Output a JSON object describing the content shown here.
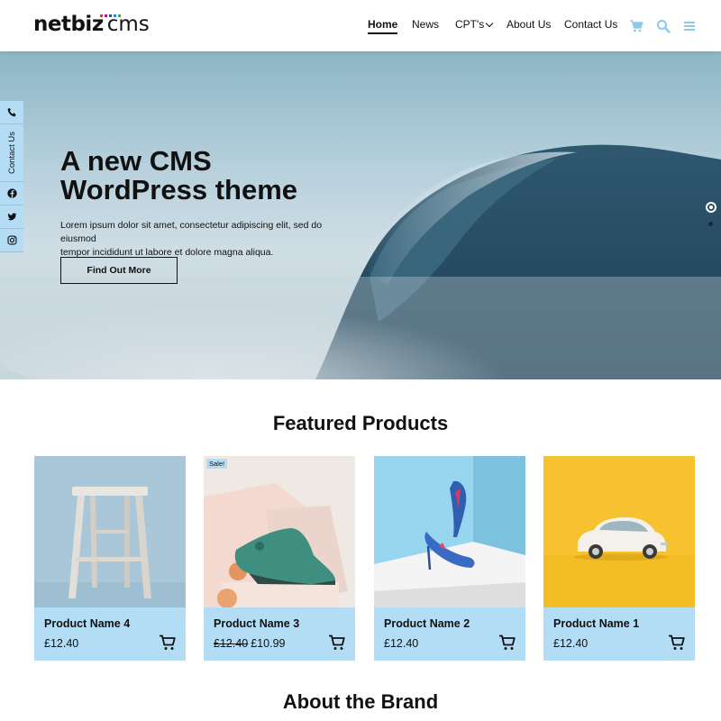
{
  "header": {
    "logo_bold": "netbiz",
    "logo_light": "cms",
    "logo_dot_colors": [
      "#e53935",
      "#8e24aa",
      "#3949ab",
      "#1e88e5",
      "#43a047"
    ],
    "nav": [
      "Home",
      "News",
      "CPT's",
      "About Us",
      "Contact Us"
    ],
    "icon_color": "#8ec8ea"
  },
  "side_tabs": {
    "contact_label": "Contact Us",
    "icons": [
      "phone-icon",
      "facebook-icon",
      "twitter-icon",
      "instagram-icon"
    ]
  },
  "hero": {
    "title_line1": "A new CMS",
    "title_line2": "WordPress theme",
    "text_line1": "Lorem ipsum dolor sit amet, consectetur adipiscing elit, sed do eiusmod",
    "text_line2": "tempor incididunt ut labore et dolore magna aliqua.",
    "button": "Find Out More",
    "slides": 2,
    "active_slide": 1
  },
  "featured": {
    "title": "Featured Products",
    "products": [
      {
        "name": "Product Name 4",
        "price": "£12.40",
        "old_price": "",
        "sale": false
      },
      {
        "name": "Product Name 3",
        "price": "£10.99",
        "old_price": "£12.40",
        "sale": true,
        "sale_label": "Sale!"
      },
      {
        "name": "Product Name 2",
        "price": "£12.40",
        "old_price": "",
        "sale": false
      },
      {
        "name": "Product Name 1",
        "price": "£12.40",
        "old_price": "",
        "sale": false
      }
    ]
  },
  "about": {
    "title": "About the Brand"
  }
}
